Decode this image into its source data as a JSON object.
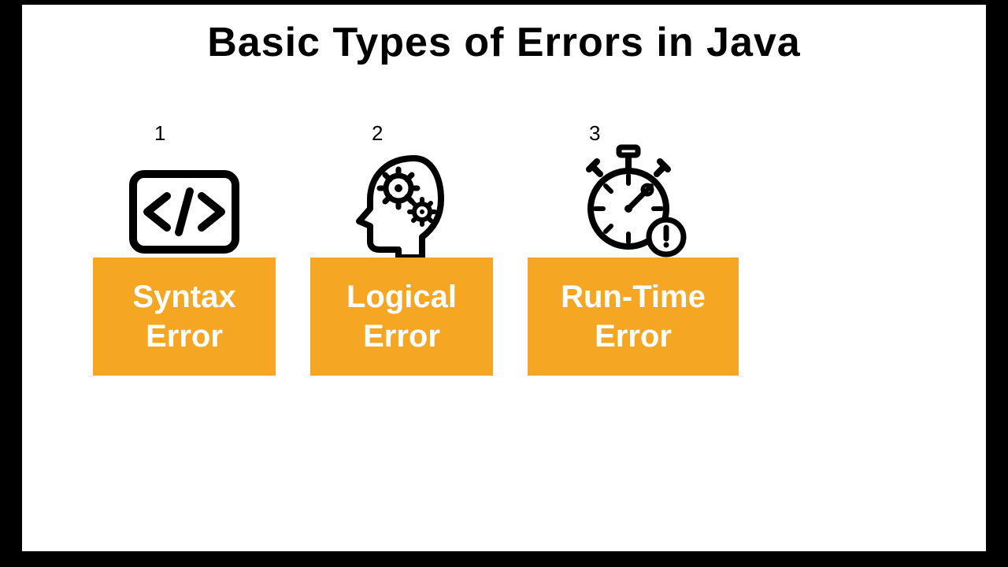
{
  "title": "Basic Types of Errors in Java",
  "cards": [
    {
      "num": "1",
      "label": "Syntax\nError",
      "icon": "code-tag-icon"
    },
    {
      "num": "2",
      "label": "Logical\nError",
      "icon": "head-gears-icon"
    },
    {
      "num": "3",
      "label": "Run-Time\nError",
      "icon": "stopwatch-alert-icon"
    }
  ],
  "colors": {
    "accent": "#f5a623",
    "frame": "#000000",
    "bg": "#ffffff"
  }
}
